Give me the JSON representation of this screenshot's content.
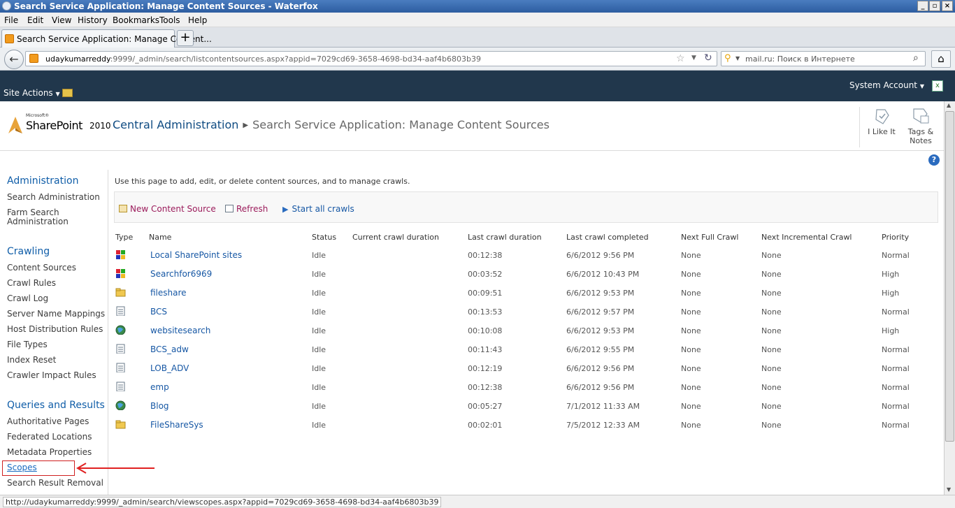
{
  "window": {
    "title": "Search Service Application: Manage Content Sources - Waterfox"
  },
  "menu": [
    "File",
    "Edit",
    "View",
    "History",
    "Bookmarks",
    "Tools",
    "Help"
  ],
  "tab": {
    "label": "Search Service Application: Manage Content..."
  },
  "url": {
    "host": "udaykumarreddy",
    "rest": ":9999/_admin/search/listcontentsources.aspx?appid=7029cd69-3658-4698-bd34-aaf4b6803b39"
  },
  "search": {
    "placeholder": "mail.ru: Поиск в Интернете"
  },
  "ribbon": {
    "site_actions": "Site Actions",
    "account": "System Account"
  },
  "header": {
    "logo_small": "Microsoft®",
    "logo_main": "SharePoint",
    "logo_year": "2010",
    "crumb_root": "Central Administration",
    "crumb_current": "Search Service Application: Manage Content Sources",
    "like_label": "I Like It",
    "tags_label_1": "Tags &",
    "tags_label_2": "Notes"
  },
  "leftnav": {
    "admin_heading": "Administration",
    "admin_items": [
      "Search Administration",
      "Farm Search Administration"
    ],
    "crawling_heading": "Crawling",
    "crawling_items": [
      "Content Sources",
      "Crawl Rules",
      "Crawl Log",
      "Server Name Mappings",
      "Host Distribution Rules",
      "File Types",
      "Index Reset",
      "Crawler Impact Rules"
    ],
    "queries_heading": "Queries and Results",
    "queries_items": [
      "Authoritative Pages",
      "Federated Locations",
      "Metadata Properties",
      "Scopes",
      "Search Result Removal"
    ]
  },
  "content": {
    "intro": "Use this page to add, edit, or delete content sources, and to manage crawls.",
    "toolbar": {
      "new": "New Content Source",
      "refresh": "Refresh",
      "start": "Start all crawls"
    },
    "columns": [
      "Type",
      "Name",
      "Status",
      "Current crawl duration",
      "Last crawl duration",
      "Last crawl completed",
      "Next Full Crawl",
      "Next Incremental Crawl",
      "Priority"
    ],
    "rows": [
      {
        "type": "sharepoint",
        "name": "Local SharePoint sites",
        "status": "Idle",
        "current": "",
        "last": "00:12:38",
        "completed": "6/6/2012 9:56 PM",
        "full": "None",
        "incr": "None",
        "priority": "Normal"
      },
      {
        "type": "sharepoint",
        "name": "Searchfor6969",
        "status": "Idle",
        "current": "",
        "last": "00:03:52",
        "completed": "6/6/2012 10:43 PM",
        "full": "None",
        "incr": "None",
        "priority": "High"
      },
      {
        "type": "fileshare",
        "name": "fileshare",
        "status": "Idle",
        "current": "",
        "last": "00:09:51",
        "completed": "6/6/2012 9:53 PM",
        "full": "None",
        "incr": "None",
        "priority": "High"
      },
      {
        "type": "bcs",
        "name": "BCS",
        "status": "Idle",
        "current": "",
        "last": "00:13:53",
        "completed": "6/6/2012 9:57 PM",
        "full": "None",
        "incr": "None",
        "priority": "Normal"
      },
      {
        "type": "web",
        "name": "websitesearch",
        "status": "Idle",
        "current": "",
        "last": "00:10:08",
        "completed": "6/6/2012 9:53 PM",
        "full": "None",
        "incr": "None",
        "priority": "High"
      },
      {
        "type": "bcs",
        "name": "BCS_adw",
        "status": "Idle",
        "current": "",
        "last": "00:11:43",
        "completed": "6/6/2012 9:55 PM",
        "full": "None",
        "incr": "None",
        "priority": "Normal"
      },
      {
        "type": "bcs",
        "name": "LOB_ADV",
        "status": "Idle",
        "current": "",
        "last": "00:12:19",
        "completed": "6/6/2012 9:56 PM",
        "full": "None",
        "incr": "None",
        "priority": "Normal"
      },
      {
        "type": "bcs",
        "name": "emp",
        "status": "Idle",
        "current": "",
        "last": "00:12:38",
        "completed": "6/6/2012 9:56 PM",
        "full": "None",
        "incr": "None",
        "priority": "Normal"
      },
      {
        "type": "web",
        "name": "Blog",
        "status": "Idle",
        "current": "",
        "last": "00:05:27",
        "completed": "7/1/2012 11:33 AM",
        "full": "None",
        "incr": "None",
        "priority": "Normal"
      },
      {
        "type": "fileshare",
        "name": "FileShareSys",
        "status": "Idle",
        "current": "",
        "last": "00:02:01",
        "completed": "7/5/2012 12:33 AM",
        "full": "None",
        "incr": "None",
        "priority": "Normal"
      }
    ]
  },
  "status": {
    "text": "http://udaykumarreddy:9999/_admin/search/viewscopes.aspx?appid=7029cd69-3658-4698-bd34-aaf4b6803b39"
  }
}
